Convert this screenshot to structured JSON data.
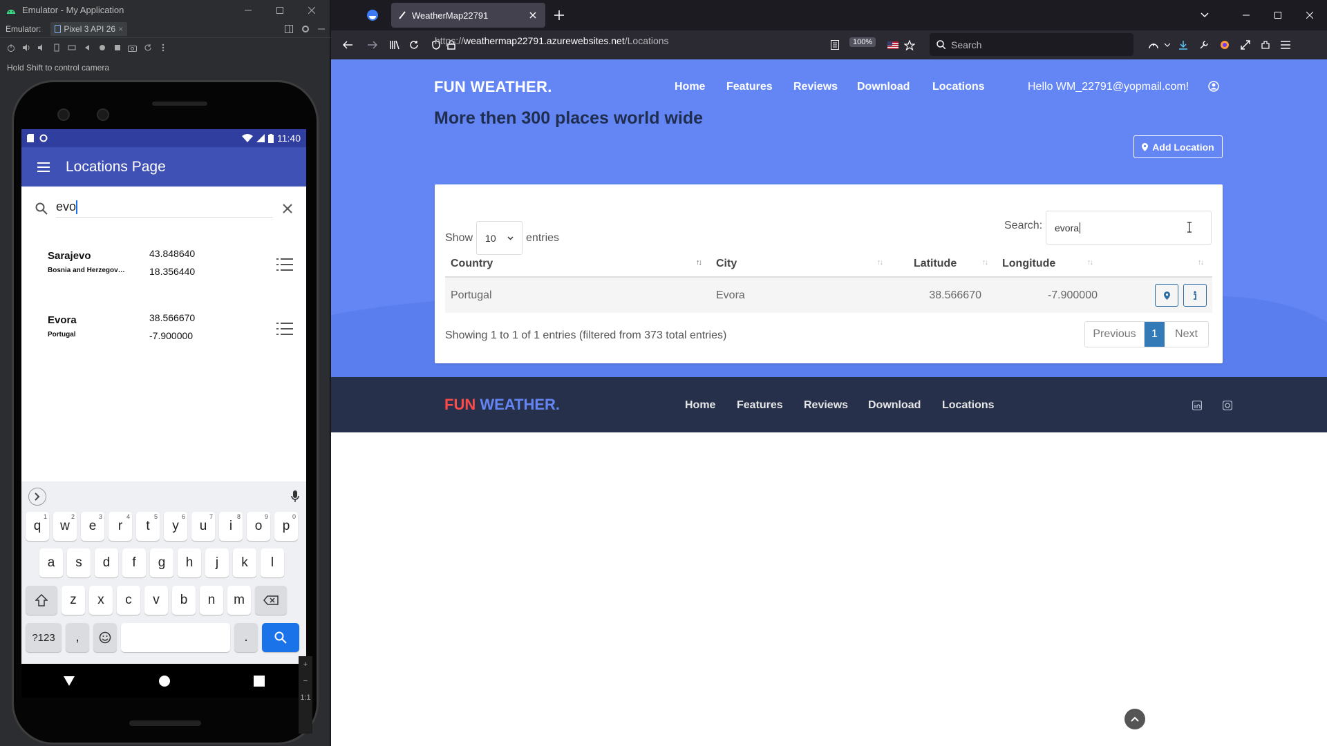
{
  "emulator": {
    "window_title": "Emulator - My Application",
    "label": "Emulator:",
    "device": "Pixel 3 API 26",
    "hint": "Hold Shift to control camera"
  },
  "phone": {
    "status_time": "11:40",
    "app_title": "Locations Page",
    "search_query": "evo",
    "locations": [
      {
        "city": "Sarajevo",
        "country": "Bosnia and Herzegovi...",
        "lat": "43.848640",
        "lon": "18.356440"
      },
      {
        "city": "Evora",
        "country": "Portugal",
        "lat": "38.566670",
        "lon": "-7.900000"
      }
    ],
    "keyboard": {
      "row1": [
        {
          "k": "q",
          "n": "1"
        },
        {
          "k": "w",
          "n": "2"
        },
        {
          "k": "e",
          "n": "3"
        },
        {
          "k": "r",
          "n": "4"
        },
        {
          "k": "t",
          "n": "5"
        },
        {
          "k": "y",
          "n": "6"
        },
        {
          "k": "u",
          "n": "7"
        },
        {
          "k": "i",
          "n": "8"
        },
        {
          "k": "o",
          "n": "9"
        },
        {
          "k": "p",
          "n": "0"
        }
      ],
      "row2": [
        "a",
        "s",
        "d",
        "f",
        "g",
        "h",
        "j",
        "k",
        "l"
      ],
      "row3": [
        "z",
        "x",
        "c",
        "v",
        "b",
        "n",
        "m"
      ],
      "sym": "?123",
      "comma": ",",
      "period": "."
    },
    "zoom_label": "1:1"
  },
  "browser": {
    "tab_title": "WeatherMap22791",
    "url_prefix": "https://",
    "url_host": "weathermap22791.azurewebsites.net",
    "url_path": "/Locations",
    "zoom": "100%",
    "search_placeholder": "Search"
  },
  "site": {
    "brand": "FUN WEATHER.",
    "nav": [
      "Home",
      "Features",
      "Reviews",
      "Download",
      "Locations"
    ],
    "hello": "Hello WM_22791@yopmail.com!",
    "headline": "More then 300 places world wide",
    "add_location": "Add Location",
    "table": {
      "show_label": "Show",
      "entries_label": "entries",
      "page_length": "10",
      "search_label": "Search:",
      "search_value": "evora",
      "columns": [
        "Country",
        "City",
        "Latitude",
        "Longitude"
      ],
      "rows": [
        {
          "country": "Portugal",
          "city": "Evora",
          "lat": "38.566670",
          "lon": "-7.900000"
        }
      ],
      "info": "Showing 1 to 1 of 1 entries (filtered from 373 total entries)",
      "prev": "Previous",
      "page": "1",
      "next": "Next"
    },
    "footer": {
      "brand_a": "FUN",
      "brand_b": "WEATHER.",
      "nav": [
        "Home",
        "Features",
        "Reviews",
        "Download",
        "Locations"
      ]
    }
  },
  "colors": {
    "hero_bg": "#6486f4",
    "footer_bg": "#26304b",
    "primary": "#337ab7",
    "app_bar": "#3f51b5"
  }
}
